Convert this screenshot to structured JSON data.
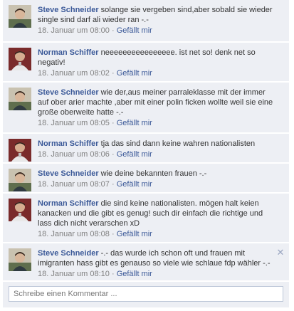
{
  "comments": [
    {
      "author": "Steve Schneider",
      "text": "solange sie vergeben sind,aber sobald sie wieder single sind darf ali wieder ran -.-",
      "time": "18. Januar um 08:00",
      "like_label": "Gefällt mir",
      "avatar_icon": "user-photo"
    },
    {
      "author": "Norman Schiffer",
      "text": "neeeeeeeeeeeeeeee. ist net so! denk net so negativ!",
      "time": "18. Januar um 08:02",
      "like_label": "Gefällt mir",
      "avatar_icon": "user-photo"
    },
    {
      "author": "Steve Schneider",
      "text": "wie der,aus meiner parraleklasse mit der immer auf ober arier machte ,aber mit einer polin ficken wollte weil sie eine große oberweite hatte -.-",
      "time": "18. Januar um 08:05",
      "like_label": "Gefällt mir",
      "avatar_icon": "user-photo"
    },
    {
      "author": "Norman Schiffer",
      "text": "tja das sind dann keine wahren nationalisten",
      "time": "18. Januar um 08:06",
      "like_label": "Gefällt mir",
      "avatar_icon": "user-photo"
    },
    {
      "author": "Steve Schneider",
      "text": "wie deine bekannten frauen -.-",
      "time": "18. Januar um 08:07",
      "like_label": "Gefällt mir",
      "avatar_icon": "user-photo"
    },
    {
      "author": "Norman Schiffer",
      "text": "die sind keine nationalisten. mögen halt keien kanacken und die gibt es genug! such dir einfach die richtige und lass dich nicht verarschen xD",
      "time": "18. Januar um 08:08",
      "like_label": "Gefällt mir",
      "avatar_icon": "user-photo"
    },
    {
      "author": "Steve Schneider",
      "text": "-.- das wurde ich schon oft und frauen mit imigranten hass gibt es genauso so viele wie schlaue fdp wähler -.-",
      "time": "18. Januar um 08:10",
      "like_label": "Gefällt mir",
      "avatar_icon": "user-photo",
      "close_icon": "close-icon"
    }
  ],
  "composer": {
    "placeholder": "Schreibe einen Kommentar ..."
  },
  "colors": {
    "background": "#edeff4",
    "author_link": "#3b5998",
    "meta_text": "#808080",
    "input_border": "#bdc7d8"
  }
}
